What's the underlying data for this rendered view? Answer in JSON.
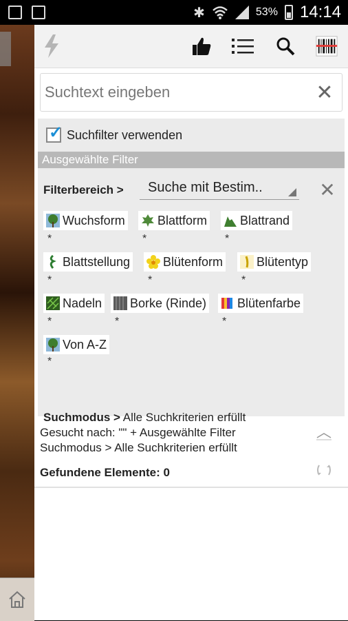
{
  "status_bar": {
    "battery_percent": "53%",
    "time": "14:14",
    "icons": [
      "image-icon",
      "photo-sync-icon",
      "bluetooth-icon",
      "wifi-icon",
      "signal-icon",
      "battery-icon"
    ]
  },
  "toolbar": {
    "icons": [
      "flash-icon",
      "thumbs-up-icon",
      "list-icon",
      "search-icon",
      "barcode-icon"
    ]
  },
  "search": {
    "placeholder": "Suchtext eingeben",
    "value": ""
  },
  "filter": {
    "use_filter_label": "Suchfilter verwenden",
    "use_filter_checked": true,
    "selected_header": "Ausgewählte Filter",
    "area_label": "Filterbereich >",
    "area_value": "Suche mit Bestim..",
    "chips": [
      {
        "label": "Wuchsform",
        "star": "*"
      },
      {
        "label": "Blattform",
        "star": "*"
      },
      {
        "label": "Blattrand",
        "star": "*"
      },
      {
        "label": "Blattstellung",
        "star": "*"
      },
      {
        "label": "Blütenform",
        "star": "*"
      },
      {
        "label": "Blütentyp",
        "star": "*"
      },
      {
        "label": "Nadeln",
        "star": "*"
      },
      {
        "label": "Borke (Rinde)",
        "star": "*"
      },
      {
        "label": "Blütenfarbe",
        "star": "*"
      },
      {
        "label": "Von A-Z",
        "star": "*"
      }
    ],
    "mode_label": "Suchmodus >",
    "mode_value": "Alle Suchkriterien erfüllt"
  },
  "results": {
    "searched_for": "Gesucht nach:  \"\" + Ausgewählte Filter",
    "mode_line": "Suchmodus > Alle Suchkriterien erfüllt",
    "found": "Gefundene Elemente: 0"
  },
  "colors": {
    "accent_blue": "#1b8fd6",
    "header_gray": "#b8b8b8",
    "barcode_red": "#e53935"
  }
}
